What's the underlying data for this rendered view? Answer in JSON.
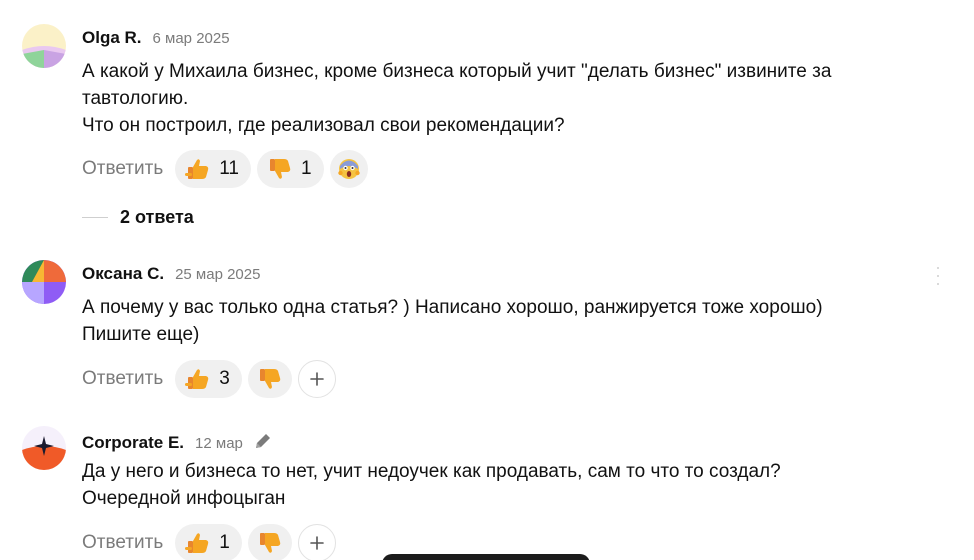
{
  "colors": {
    "text": "#111111",
    "muted": "#7b7b7b",
    "pill_bg": "#f0f0f0",
    "thumb": "#f5a623",
    "thumb_down": "#e8862e"
  },
  "comments": [
    {
      "author": "Olga R.",
      "date": "6 мар 2025",
      "text": "А какой у Михаила бизнес, кроме бизнеса который учит \"делать бизнес\" извините за\nтавтологию.\nЧто он построил, где реализовал свои рекомендации?",
      "reply_label": "Ответить",
      "likes": "11",
      "dislikes": "1",
      "extra_reaction_icon": "scream-emoji-icon",
      "replies_label": "2 ответа"
    },
    {
      "author": "Оксана С.",
      "date": "25 мар 2025",
      "text": "А почему у вас только одна статья? ) Написано хорошо, ранжируется тоже хорошо)\nПишите еще)",
      "reply_label": "Ответить",
      "likes": "3",
      "add_reaction_icon": "plus-icon"
    },
    {
      "author": "Corporate E.",
      "date": "12 мар",
      "text": "Да у него и бизнеса то нет, учит недоучек как продавать, сам то что то создал?\nОчередной инфоцыган",
      "reply_label": "Ответить",
      "likes": "1",
      "edited_icon": "pencil-icon",
      "add_reaction_icon": "plus-icon"
    }
  ]
}
